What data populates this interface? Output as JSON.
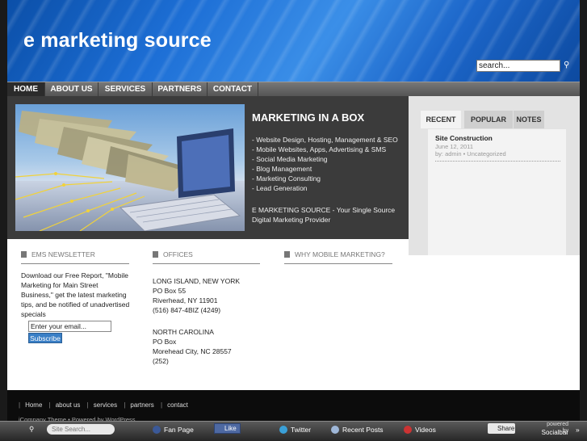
{
  "header": {
    "site_title": "e marketing source",
    "search_value": "search..."
  },
  "nav": {
    "items": [
      {
        "label": "HOME"
      },
      {
        "label": "ABOUT US"
      },
      {
        "label": "SERVICES"
      },
      {
        "label": "PARTNERS"
      },
      {
        "label": "CONTACT"
      }
    ]
  },
  "feature": {
    "title": "MARKETING IN A BOX",
    "list": [
      "- Website Design, Hosting, Management & SEO",
      "- Mobile Websites, Apps, Advertising & SMS",
      "- Social Media Marketing",
      "- Blog Management",
      "- Marketing Consulting",
      "- Lead Generation"
    ],
    "tagline": "E MARKETING SOURCE - Your Single Source Digital Marketing Provider"
  },
  "tabs": {
    "items": [
      {
        "label": "RECENT"
      },
      {
        "label": "POPULAR"
      },
      {
        "label": "NOTES"
      }
    ],
    "post": {
      "title": "Site Construction",
      "date": "June 12, 2011",
      "meta": "by: admin • Uncategorized"
    }
  },
  "widgets": {
    "newsletter": {
      "title": "EMS NEWSLETTER",
      "body": "Download our Free Report, \"Mobile Marketing for Main Street Business,\" get the latest marketing tips, and be notified of unadvertised specials",
      "email_value": "Enter your email...",
      "subscribe_label": "Subscribe"
    },
    "offices": {
      "title": "OFFICES",
      "ny": [
        "LONG ISLAND, NEW YORK",
        "PO Box 55",
        "Riverhead, NY 11901",
        "(516) 847-4BIZ (4249)"
      ],
      "nc": [
        "NORTH CAROLINA",
        "PO Box",
        "Morehead City, NC 28557",
        "(252)"
      ]
    },
    "mobile": {
      "title": "WHY MOBILE MARKETING?"
    }
  },
  "footer": {
    "links": [
      {
        "label": "Home"
      },
      {
        "label": "about us"
      },
      {
        "label": "services"
      },
      {
        "label": "partners"
      },
      {
        "label": "contact"
      }
    ],
    "credit": "iCompany Theme • Powered by WordPress"
  },
  "socialbar": {
    "search_placeholder": "Site Search...",
    "fan_page": "Fan Page",
    "like": "Like",
    "twitter": "Twitter",
    "recent_posts": "Recent Posts",
    "videos": "Videos",
    "share": "Share",
    "powered_by": "powered by",
    "brand": "Socialbar"
  }
}
